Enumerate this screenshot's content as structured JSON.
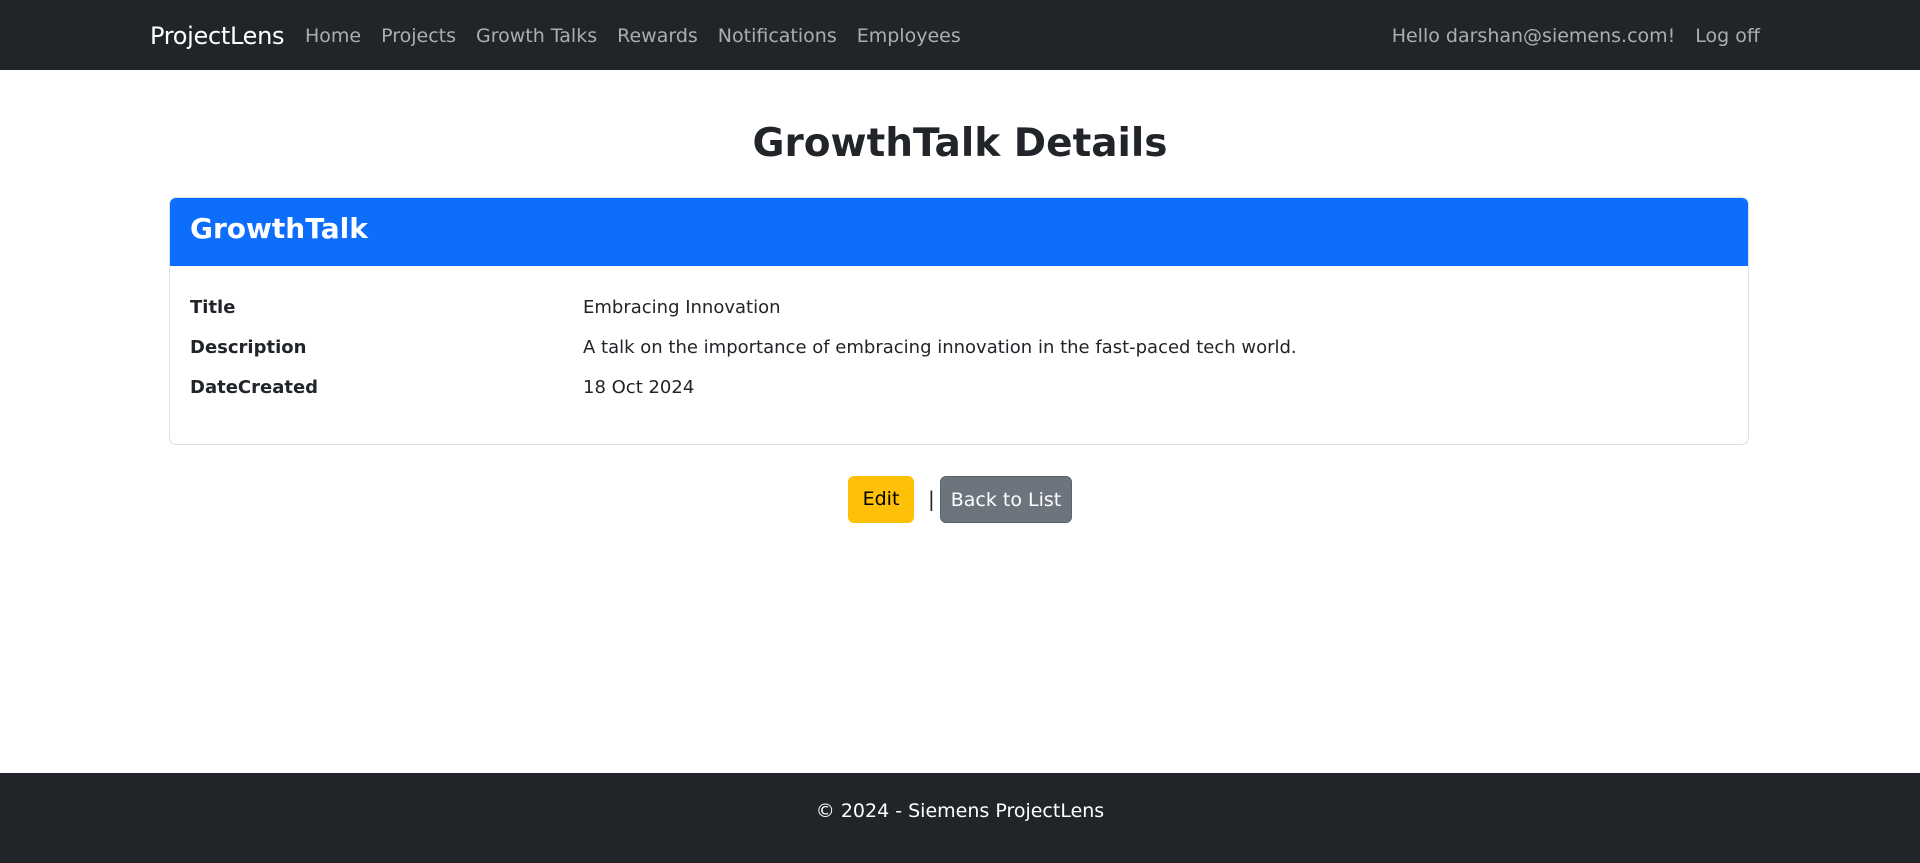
{
  "navbar": {
    "brand": "ProjectLens",
    "links": [
      "Home",
      "Projects",
      "Growth Talks",
      "Rewards",
      "Notifications",
      "Employees"
    ],
    "greeting": "Hello darshan@siemens.com!",
    "logoff": "Log off"
  },
  "page": {
    "title": "GrowthTalk Details"
  },
  "card": {
    "header": "GrowthTalk",
    "fields": [
      {
        "label": "Title",
        "value": "Embracing Innovation"
      },
      {
        "label": "Description",
        "value": "A talk on the importance of embracing innovation in the fast-paced tech world."
      },
      {
        "label": "DateCreated",
        "value": "18 Oct 2024"
      }
    ]
  },
  "actions": {
    "edit_label": "Edit",
    "separator": "|",
    "back_label": "Back to List"
  },
  "footer": {
    "text": "© 2024 - Siemens ProjectLens"
  },
  "colors": {
    "navbar_bg": "#212529",
    "card_header_bg": "#0d6efd",
    "edit_button_bg": "#ffc107",
    "back_button_bg": "#6c757d"
  }
}
